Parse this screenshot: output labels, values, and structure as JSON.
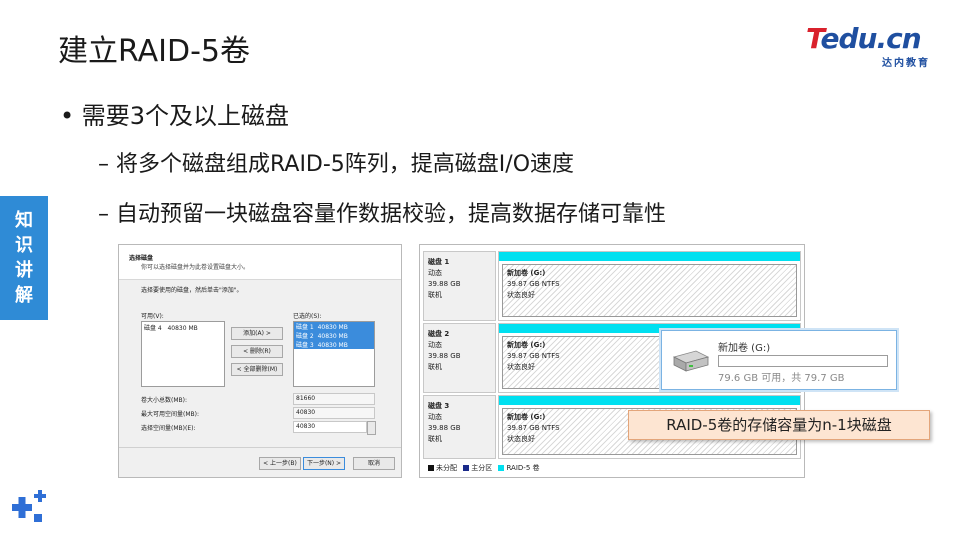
{
  "title": "建立RAID-5卷",
  "logo": {
    "brand_t": "T",
    "brand_rest": "edu.cn",
    "subtitle": "达内教育"
  },
  "side_tag": [
    "知",
    "识",
    "讲",
    "解"
  ],
  "bullets": {
    "b1": "• 需要3个及以上磁盘",
    "b2": "– 将多个磁盘组成RAID-5阵列，提高磁盘I/O速度",
    "b3": "– 自动预留一块磁盘容量作数据校验，提高数据存储可靠性"
  },
  "dialog": {
    "title": "选择磁盘",
    "subtitle": "你可以选择磁盘并为此卷设置磁盘大小。",
    "instruction": "选择要使用的磁盘，然后单击\"添加\"。",
    "available_label": "可用(V):",
    "available_items": [
      {
        "disk": "磁盘 4",
        "size": "40830 MB"
      }
    ],
    "selected_label": "已选的(S):",
    "selected_items": [
      {
        "disk": "磁盘 1",
        "size": "40830 MB"
      },
      {
        "disk": "磁盘 2",
        "size": "40830 MB"
      },
      {
        "disk": "磁盘 3",
        "size": "40830 MB"
      }
    ],
    "btn_add": "添加(A) >",
    "btn_remove": "< 删除(R)",
    "btn_remove_all": "< 全部删除(M)",
    "total_label": "卷大小总数(MB):",
    "total_value": "81660",
    "max_label": "最大可用空间量(MB):",
    "max_value": "40830",
    "select_label": "选择空间量(MB)(E):",
    "select_value": "40830",
    "btn_back": "< 上一步(B)",
    "btn_next": "下一步(N) >",
    "btn_cancel": "取消"
  },
  "disk_manager": {
    "disks": [
      {
        "name": "磁盘 1",
        "type": "动态",
        "size": "39.88 GB",
        "status": "联机",
        "volume": "新加卷 (G:)",
        "vol_size": "39.87 GB NTFS",
        "vol_status": "状态良好"
      },
      {
        "name": "磁盘 2",
        "type": "动态",
        "size": "39.88 GB",
        "status": "联机",
        "volume": "新加卷 (G:)",
        "vol_size": "39.87 GB NTFS",
        "vol_status": "状态良好"
      },
      {
        "name": "磁盘 3",
        "type": "动态",
        "size": "39.88 GB",
        "status": "联机",
        "volume": "新加卷 (G:)",
        "vol_size": "39.87 GB NTFS",
        "vol_status": "状态良好"
      }
    ],
    "legend": [
      {
        "label": "未分配",
        "color": "#111111"
      },
      {
        "label": "主分区",
        "color": "#1a2a8a"
      },
      {
        "label": "RAID-5 卷",
        "color": "#00e0f0"
      }
    ]
  },
  "volume_tip": {
    "name": "新加卷 (G:)",
    "capacity": "79.6 GB 可用，共 79.7 GB"
  },
  "callout": "RAID-5卷的存储容量为n-1块磁盘",
  "colors": {
    "accent_blue": "#2f8bd6",
    "raid_cyan": "#00e0f0",
    "callout_bg": "#fde5d2"
  }
}
